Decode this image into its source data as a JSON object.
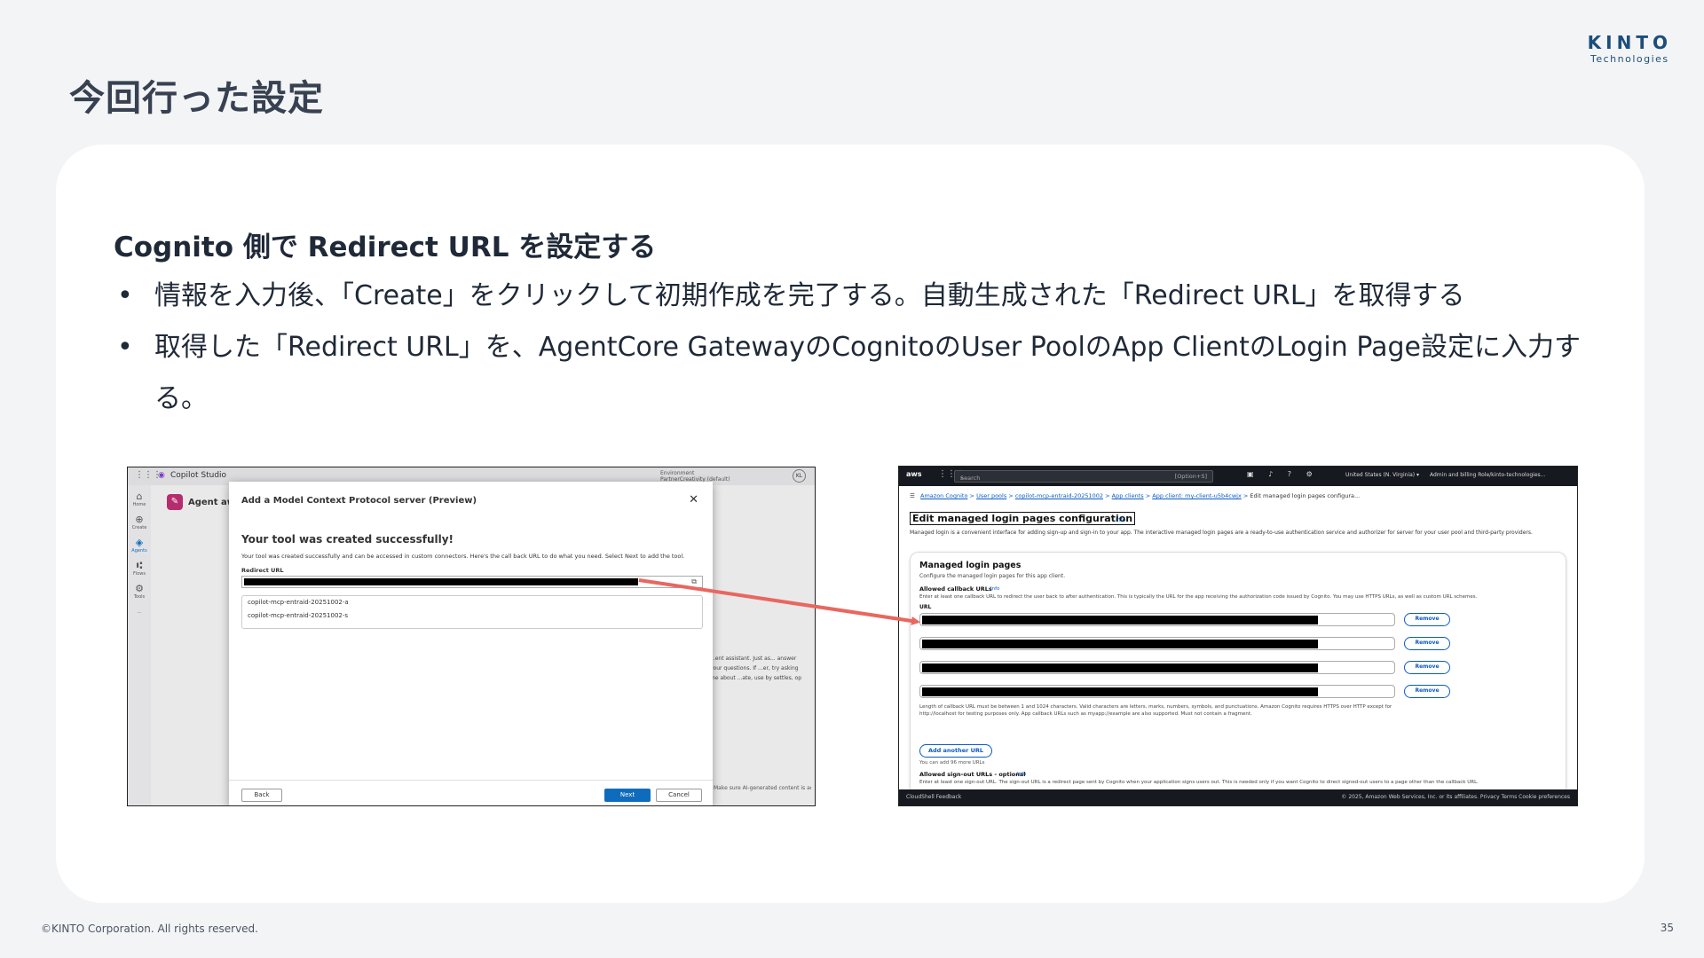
{
  "slide": {
    "title": "今回行った設定",
    "heading": "Cognito 側で Redirect URL を設定する",
    "bullets": [
      "情報を入力後、「Create」をクリックして初期作成を完了する。自動生成された「Redirect URL」を取得する",
      "取得した「Redirect URL」を、AgentCore GatewayのCognitoのUser PoolのApp ClientのLogin Page設定に入力する。"
    ],
    "copyright": "©KINTO Corporation. All rights reserved.",
    "page_number": "35",
    "accent_color": "#e8675f"
  },
  "logo": {
    "word": "KINTO",
    "sub": "Technologies"
  },
  "copilot": {
    "app_title": "Copilot Studio",
    "environment": "Environment\nPartnerCreativity (default)",
    "agent_name": "Agent aw",
    "nav": [
      "Home",
      "Create",
      "Agents",
      "Flows",
      "Tools",
      "..."
    ],
    "right_text": "...ent assistant. Just as... answer your questions. If ...er, try asking me about ...ate, use by settles, op",
    "note": "Make sure AI-generated content is accurate and appropriate before using. See",
    "modal": {
      "title": "Add a Model Context Protocol server (Preview)",
      "heading": "Your tool was created successfully!",
      "description": "Your tool was created successfully and can be accessed in custom connectors. Here's the call back URL to do what you need. Select Next to add the tool.",
      "url_label": "Redirect URL",
      "items": [
        "copilot-mcp-entraid-20251002-a",
        "copilot-mcp-entraid-20251002-s"
      ],
      "back": "Back",
      "next": "Next",
      "cancel": "Cancel"
    }
  },
  "aws": {
    "logo": "aws",
    "search_placeholder": "Search",
    "search_hint": "[Option+S]",
    "region": "United States (N. Virginia) ▾",
    "account": "Admin and billing Role/kinto-technologies...",
    "breadcrumb": [
      "Amazon Cognito",
      "User pools",
      "copilot-mcp-entraid-20251002",
      "App clients",
      "App client: my-client-u5b4cwjx"
    ],
    "breadcrumb_current": "Edit managed login pages configura...",
    "page_title": "Edit managed login pages configuration",
    "info": "Info",
    "intro": "Managed login is a convenient interface for adding sign-up and sign-in to your app. The interactive managed login pages are a ready-to-use authentication service and authorizer for server for your user pool and third-party providers.",
    "panel_title": "Managed login pages",
    "panel_sub": "Configure the managed login pages for this app client.",
    "callback_label": "Allowed callback URLs",
    "callback_help": "Enter at least one callback URL to redirect the user back to after authentication. This is typically the URL for the app receiving the authorization code issued by Cognito. You may use HTTPS URLs, as well as custom URL schemes.",
    "url_header": "URL",
    "remove": "Remove",
    "constraint": "Length of callback URL must be between 1 and 1024 characters. Valid characters are letters, marks, numbers, symbols, and punctuations. Amazon Cognito requires HTTPS over HTTP except for http://localhost for testing purposes only. App callback URLs such as myapp://example are also supported. Must not contain a fragment.",
    "add_button": "Add another URL",
    "add_note": "You can add 96 more URLs",
    "signout_label": "Allowed sign-out URLs - optional",
    "signout_help": "Enter at least one sign-out URL. The sign-out URL is a redirect page sent by Cognito when your application signs users out. This is needed only if you want Cognito to direct signed-out users to a page other than the callback URL.",
    "footer_left": "CloudShell   Feedback",
    "footer_right": "© 2025, Amazon Web Services, Inc. or its affiliates.   Privacy   Terms   Cookie preferences"
  }
}
